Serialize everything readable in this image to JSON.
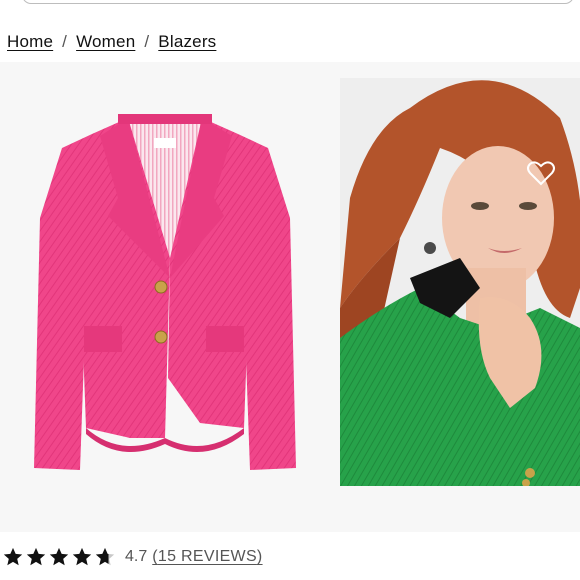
{
  "breadcrumb": {
    "items": [
      "Home",
      "Women",
      "Blazers"
    ],
    "separator": "/"
  },
  "gallery": {
    "images": [
      {
        "name": "pink-tweed-blazer-flat",
        "color": "#f0468a"
      },
      {
        "name": "model-green-tweed-blazer",
        "color": "#27a24a"
      }
    ]
  },
  "rating": {
    "value": "4.7",
    "open_paren": "(",
    "reviews_label": "15 REVIEWS",
    "close_paren": ")",
    "stars_filled": 4.7,
    "stars_total": 5,
    "star_color": "#111111"
  }
}
